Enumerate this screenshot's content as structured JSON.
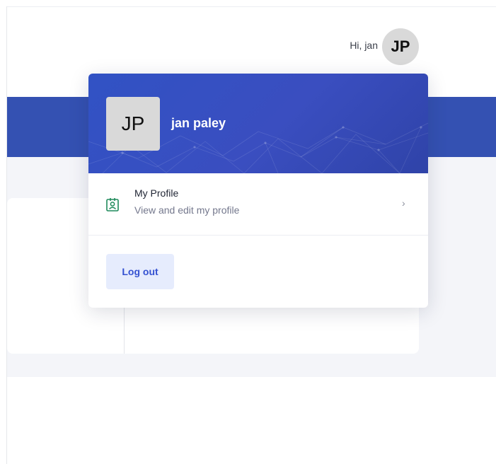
{
  "header": {
    "greeting": "Hi, jan",
    "avatar_initials": "JP"
  },
  "dropdown": {
    "avatar_initials": "JP",
    "user_name": "jan paley",
    "profile_item": {
      "title": "My Profile",
      "subtitle": "View and edit my profile",
      "icon": "profile-badge-icon",
      "chevron": "›"
    },
    "logout_label": "Log out"
  },
  "colors": {
    "primary_blue": "#3451b2",
    "header_gradient_start": "#3152c4",
    "header_gradient_end": "#2f43a8",
    "logout_bg": "#e6ecfd",
    "logout_text": "#3451d1",
    "profile_icon": "#1f8a5b",
    "page_gray": "#f4f5f9"
  }
}
